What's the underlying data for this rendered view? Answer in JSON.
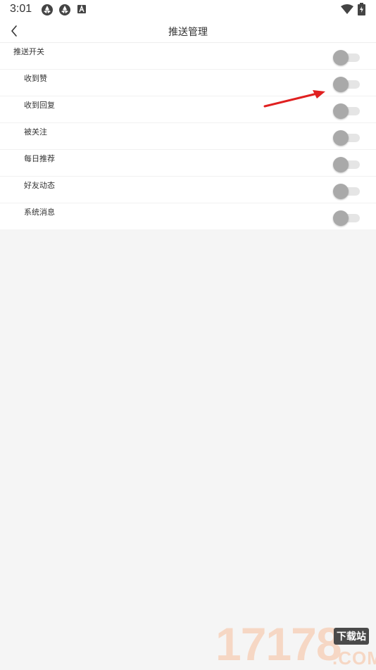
{
  "status_bar": {
    "time": "3:01",
    "icons_left": [
      "aperture-icon",
      "aperture-icon",
      "font-a-icon"
    ],
    "icons_right": [
      "wifi-icon",
      "battery-charging-icon"
    ]
  },
  "header": {
    "back_icon": "chevron-left-icon",
    "title": "推送管理"
  },
  "settings": {
    "items": [
      {
        "label": "推送开关",
        "enabled": false
      },
      {
        "label": "收到赞",
        "enabled": false
      },
      {
        "label": "收到回复",
        "enabled": false
      },
      {
        "label": "被关注",
        "enabled": false
      },
      {
        "label": "每日推荐",
        "enabled": false
      },
      {
        "label": "好友动态",
        "enabled": false
      },
      {
        "label": "系统消息",
        "enabled": false
      }
    ]
  },
  "annotation": {
    "arrow_color": "#e02020"
  },
  "watermark": {
    "number": "17178",
    "tag": "下载站",
    "domain": ".COM"
  },
  "colors": {
    "toggle_knob": "#a9a9a9",
    "toggle_track": "#e5e5e5",
    "background": "#f5f5f5"
  }
}
